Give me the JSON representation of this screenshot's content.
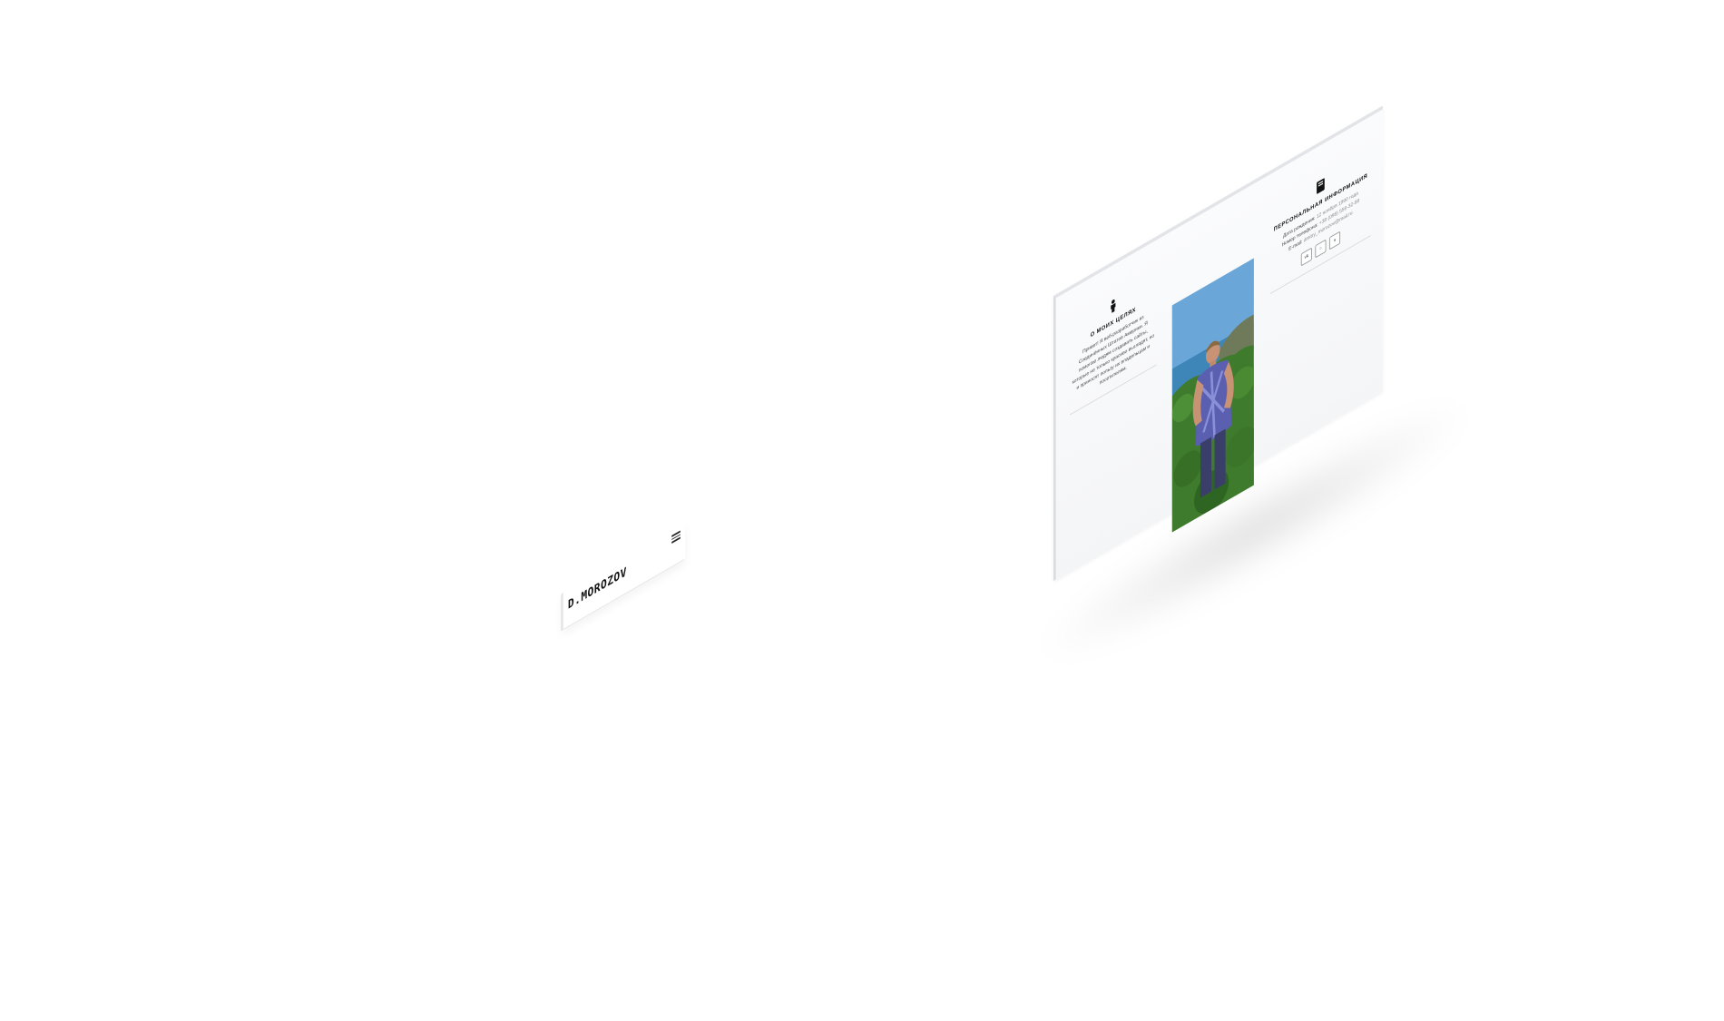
{
  "mobile_header": {
    "logo": "D.MOROZOV",
    "menu_icon": "hamburger-menu-icon"
  },
  "about": {
    "icon": "person-icon",
    "title": "О МОИХ ЦЕЛЯХ",
    "text": "Привет! Я веб-разработчик из Соединённых Штатов Америки. Я помогаю людям создавать сайты, которые не только красиво выглядят, но и приносят пользу их владельцам и посетителям."
  },
  "photo": {
    "alt": "Портрет"
  },
  "personal": {
    "icon": "book-icon",
    "title": "ПЕРСОНАЛЬНАЯ ИНФОРМАЦИЯ",
    "lines": [
      {
        "label": "Дата рождения:",
        "value": "12 ноября 1990 года"
      },
      {
        "label": "Номер телефона:",
        "value": "+38 (098) 556-32-98"
      },
      {
        "label": "E-mail:",
        "value": "dmitry_morozov@mail.ru"
      }
    ],
    "socials": [
      {
        "name": "vk-icon",
        "glyph": "vk"
      },
      {
        "name": "github-icon",
        "glyph": "○"
      },
      {
        "name": "skype-icon",
        "glyph": "s"
      }
    ]
  },
  "colors": {
    "text": "#222222",
    "muted": "#888888",
    "panel": "#f7f8fa",
    "rule": "#d7d9dc"
  }
}
